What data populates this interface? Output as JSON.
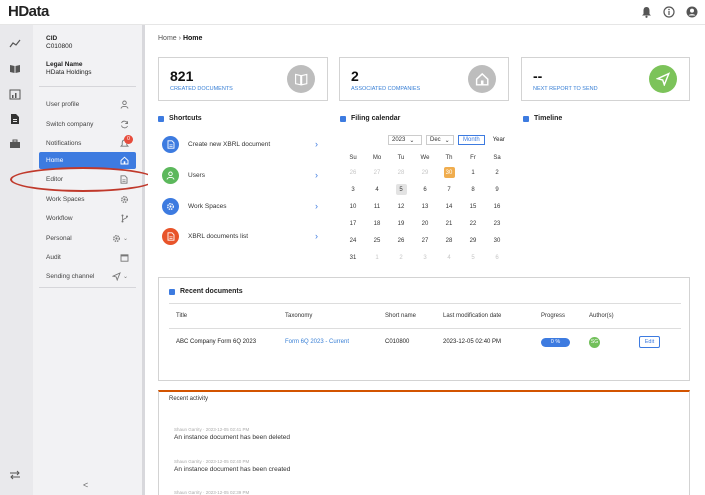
{
  "app": {
    "logo": "HData",
    "header_icons": [
      "bell-icon",
      "info-icon",
      "user-icon"
    ]
  },
  "rail_icons": [
    "trend-icon",
    "book-icon",
    "chart-add-icon",
    "document-icon",
    "briefcase-icon",
    "transfer-icon"
  ],
  "sidebar": {
    "cid_label": "CID",
    "cid_value": "C010800",
    "legal_name_label": "Legal Name",
    "legal_name_value": "HData Holdings",
    "items": [
      {
        "label": "User profile",
        "icon": "user-icon"
      },
      {
        "label": "Switch company",
        "icon": "refresh-icon"
      },
      {
        "label": "Notifications",
        "icon": "bell-icon",
        "badge": "0"
      },
      {
        "label": "Home",
        "icon": "home-icon",
        "active": true
      },
      {
        "label": "Editor",
        "icon": "document-icon"
      },
      {
        "label": "Work Spaces",
        "icon": "gear-icon"
      },
      {
        "label": "Workflow",
        "icon": "branch-icon"
      },
      {
        "label": "Personal",
        "icon": "gear-icon",
        "expandable": true
      },
      {
        "label": "Audit",
        "icon": "calendar-icon"
      },
      {
        "label": "Sending channel",
        "icon": "send-icon",
        "expandable": true
      }
    ],
    "collapse_glyph": "<"
  },
  "breadcrumb": {
    "root": "Home",
    "separator": "›",
    "current": "Home"
  },
  "cards": [
    {
      "number": "821",
      "label": "CREATED DOCUMENTS",
      "icon": "book-icon",
      "color": "#bdbdbd"
    },
    {
      "number": "2",
      "label": "ASSOCIATED COMPANIES",
      "icon": "home-icon",
      "color": "#bdbdbd"
    },
    {
      "number": "--",
      "label": "NEXT REPORT TO SEND",
      "icon": "send-icon",
      "color": "#7cc35a"
    }
  ],
  "shortcuts": {
    "title": "Shortcuts",
    "items": [
      {
        "label": "Create new XBRL document",
        "color": "#3d7be0",
        "icon": "document-icon"
      },
      {
        "label": "Users",
        "color": "#5cb85c",
        "icon": "user-icon"
      },
      {
        "label": "Work Spaces",
        "color": "#3d7be0",
        "icon": "gear-icon"
      },
      {
        "label": "XBRL documents list",
        "color": "#e8542a",
        "icon": "document-icon"
      }
    ]
  },
  "filing_calendar": {
    "title": "Filing calendar",
    "year": "2023",
    "month": "Dec",
    "view_month": "Month",
    "view_year": "Year",
    "weekdays": [
      "Su",
      "Mo",
      "Tu",
      "We",
      "Th",
      "Fr",
      "Sa"
    ],
    "days": [
      {
        "d": "26",
        "m": true
      },
      {
        "d": "27",
        "m": true
      },
      {
        "d": "28",
        "m": true
      },
      {
        "d": "29",
        "m": true
      },
      {
        "d": "30",
        "today": true
      },
      {
        "d": "1"
      },
      {
        "d": "2"
      },
      {
        "d": "3"
      },
      {
        "d": "4"
      },
      {
        "d": "5",
        "sel": true
      },
      {
        "d": "6"
      },
      {
        "d": "7"
      },
      {
        "d": "8"
      },
      {
        "d": "9"
      },
      {
        "d": "10"
      },
      {
        "d": "11"
      },
      {
        "d": "12"
      },
      {
        "d": "13"
      },
      {
        "d": "14"
      },
      {
        "d": "15"
      },
      {
        "d": "16"
      },
      {
        "d": "17"
      },
      {
        "d": "18"
      },
      {
        "d": "19"
      },
      {
        "d": "20"
      },
      {
        "d": "21"
      },
      {
        "d": "22"
      },
      {
        "d": "23"
      },
      {
        "d": "24"
      },
      {
        "d": "25"
      },
      {
        "d": "26"
      },
      {
        "d": "27"
      },
      {
        "d": "28"
      },
      {
        "d": "29"
      },
      {
        "d": "30"
      },
      {
        "d": "31"
      },
      {
        "d": "1",
        "m": true
      },
      {
        "d": "2",
        "m": true
      },
      {
        "d": "3",
        "m": true
      },
      {
        "d": "4",
        "m": true
      },
      {
        "d": "5",
        "m": true
      },
      {
        "d": "6",
        "m": true
      }
    ]
  },
  "timeline": {
    "title": "Timeline"
  },
  "recent_documents": {
    "title": "Recent documents",
    "columns": [
      "Title",
      "Taxonomy",
      "Short name",
      "Last modification date",
      "Progress",
      "Author(s)",
      ""
    ],
    "rows": [
      {
        "title": "ABC Company Form 6Q 2023",
        "taxonomy": "Form 6Q 2023 - Current",
        "short_name": "C010800",
        "date": "2023-12-05 02:40 PM",
        "progress": "0 %",
        "author": "SG",
        "action": "Edit"
      }
    ]
  },
  "recent_activity": {
    "title": "Recent activity",
    "items": [
      {
        "meta": "Shaun Garrity · 2023-12-05 02:41 PM",
        "text": "An instance document has been deleted"
      },
      {
        "meta": "Shaun Garrity · 2023-12-05 02:40 PM",
        "text": "An instance document has been created"
      },
      {
        "meta": "Shaun Garrity · 2023-12-05 02:39 PM",
        "text": ""
      }
    ]
  }
}
